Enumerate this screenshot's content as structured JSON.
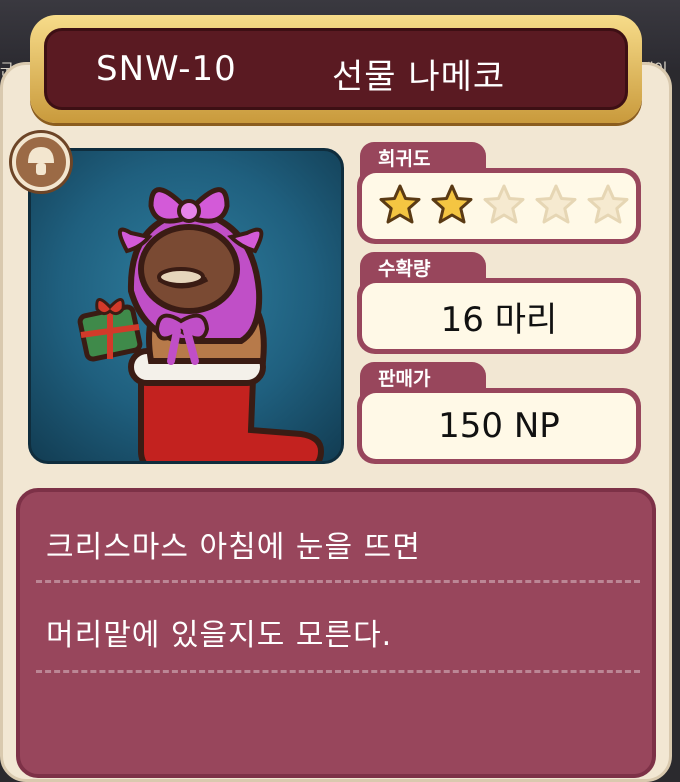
{
  "background": {
    "left_fragment": "군",
    "right_fragment": "레이"
  },
  "header": {
    "code": "SNW-10",
    "name": "선물 나메코"
  },
  "badge": {
    "icon": "mushroom-icon"
  },
  "stats": {
    "rarity": {
      "label": "희귀도",
      "filled": 2,
      "total": 5
    },
    "harvest": {
      "label": "수확량",
      "value": "16 마리"
    },
    "price": {
      "label": "판매가",
      "value": "150 NP"
    }
  },
  "description": {
    "lines": [
      "크리스마스 아침에 눈을 뜨면",
      "머리맡에 있을지도 모른다."
    ]
  },
  "colors": {
    "frame": "#98465c",
    "title_bg": "#5a1a22",
    "gold": "#e6b94f",
    "panel": "#1f5f7e"
  }
}
